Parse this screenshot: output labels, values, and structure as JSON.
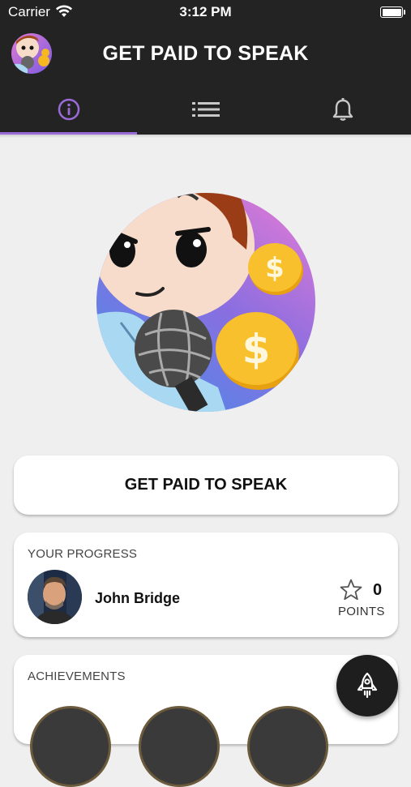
{
  "status_bar": {
    "carrier": "Carrier",
    "time": "3:12 PM"
  },
  "header": {
    "title": "GET PAID TO SPEAK",
    "avatar_icon": "mascot-avatar-icon"
  },
  "tabs": [
    {
      "icon": "info-icon",
      "active": true
    },
    {
      "icon": "list-icon",
      "active": false
    },
    {
      "icon": "bell-icon",
      "active": false
    }
  ],
  "colors": {
    "bar": "#232323",
    "accent": "#9b6bd8",
    "background": "#efefef"
  },
  "main": {
    "speak_button": "GET PAID TO SPEAK",
    "progress": {
      "title": "YOUR PROGRESS",
      "name": "John Bridge",
      "points": "0",
      "points_label": "POINTS"
    },
    "achievements": {
      "title": "ACHIEVEMENTS"
    }
  },
  "fab": {
    "icon": "rocket-icon"
  }
}
